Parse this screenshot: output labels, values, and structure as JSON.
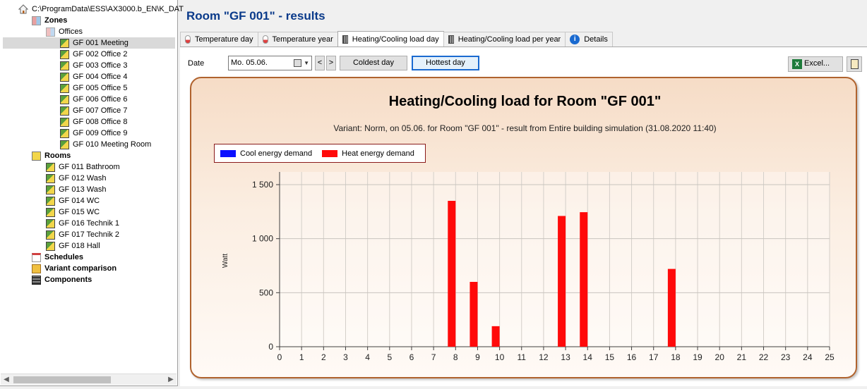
{
  "tree": {
    "path": "C:\\ProgramData\\ESS\\AX3000.b_EN\\K_DAT",
    "zones_label": "Zones",
    "offices_label": "Offices",
    "office_rooms": [
      "GF 001 Meeting",
      "GF 002 Office 2",
      "GF 003 Office 3",
      "GF 004 Office 4",
      "GF 005 Office 5",
      "GF 006 Office 6",
      "GF 007 Office 7",
      "GF 008 Office 8",
      "GF 009 Office 9",
      "GF 010 Meeting Room"
    ],
    "selected_room": "GF 001 Meeting",
    "rooms_label": "Rooms",
    "rooms": [
      "GF 011 Bathroom",
      "GF 012 Wash",
      "GF 013 Wash",
      "GF 014 WC",
      "GF 015 WC",
      "GF 016 Technik 1",
      "GF 017 Technik 2",
      "GF 018 Hall"
    ],
    "schedules_label": "Schedules",
    "variant_label": "Variant comparison",
    "components_label": "Components"
  },
  "header": {
    "title": "Room \"GF 001\" - results"
  },
  "tabs": [
    {
      "label": "Temperature day",
      "icon": "thermometer-icon"
    },
    {
      "label": "Temperature year",
      "icon": "thermometer-icon"
    },
    {
      "label": "Heating/Cooling load day",
      "icon": "radiator-icon",
      "active": true
    },
    {
      "label": "Heating/Cooling load per year",
      "icon": "radiator-icon"
    },
    {
      "label": "Details",
      "icon": "info-icon"
    }
  ],
  "toolbar": {
    "date_label": "Date",
    "date_value": "Mo. 05.06.",
    "prev": "<",
    "next": ">",
    "coldest": "Coldest day",
    "hottest": "Hottest day",
    "excel": "Excel..."
  },
  "colors": {
    "cool": "#0a10ff",
    "heat": "#ff0a0a",
    "title": "#0a3a8a",
    "panel_border": "#b0632e"
  },
  "chart_data": {
    "type": "bar",
    "title": "Heating/Cooling load for Room \"GF 001\"",
    "subtitle": "Variant: Norm, on 05.06. for Room \"GF 001\" - result from Entire building simulation (31.08.2020 11:40)",
    "legend": [
      "Cool energy demand",
      "Heat energy demand"
    ],
    "ylabel": "Watt",
    "xlim": [
      0,
      25
    ],
    "ylim": [
      0,
      1500
    ],
    "yticks": [
      0,
      500,
      1000,
      1500
    ],
    "ytick_labels": [
      "0",
      "500",
      "1 000",
      "1 500"
    ],
    "xticks": [
      0,
      1,
      2,
      3,
      4,
      5,
      6,
      7,
      8,
      9,
      10,
      11,
      12,
      13,
      14,
      15,
      16,
      17,
      18,
      19,
      20,
      21,
      22,
      23,
      24,
      25
    ],
    "series": [
      {
        "name": "Cool energy demand",
        "color": "#0a10ff",
        "points": []
      },
      {
        "name": "Heat energy demand",
        "color": "#ff0a0a",
        "points": [
          {
            "hour": 8,
            "value": 1350
          },
          {
            "hour": 9,
            "value": 600
          },
          {
            "hour": 10,
            "value": 190
          },
          {
            "hour": 13,
            "value": 1210
          },
          {
            "hour": 14,
            "value": 1245
          },
          {
            "hour": 18,
            "value": 720
          }
        ]
      }
    ],
    "grid": true
  }
}
